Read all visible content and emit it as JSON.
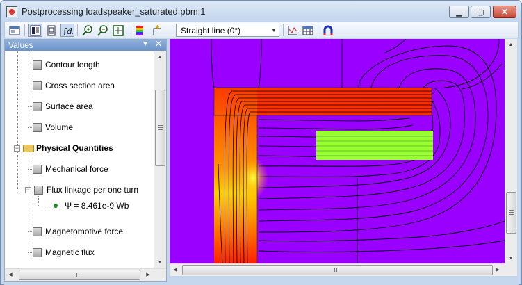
{
  "window": {
    "title": "Postprocessing loadspeaker_saturated.pbm:1",
    "minimize_symbol": "▁",
    "maximize_symbol": "▢",
    "close_symbol": "✕"
  },
  "toolbar": {
    "path_type": "Straight line (0°)",
    "icons": [
      "window-icon",
      "field-map-icon",
      "local-values-icon",
      "integral-icon",
      "zoom-in-icon",
      "zoom-out-icon",
      "zoom-fit-icon",
      "color-legend-icon",
      "new-contour-icon",
      "x-y-plot-icon",
      "table-icon",
      "magnet-icon"
    ]
  },
  "panel": {
    "title": "Values",
    "items": [
      {
        "label": "Contour length"
      },
      {
        "label": "Cross section area"
      },
      {
        "label": "Surface area"
      },
      {
        "label": "Volume"
      },
      {
        "label": "Physical Quantities"
      },
      {
        "label": "Mechanical force"
      },
      {
        "label": "Flux linkage per one turn"
      },
      {
        "label": "Ψ = 8.461e-9 Wb"
      },
      {
        "label": "Magnetomotive force"
      },
      {
        "label": "Magnetic flux"
      }
    ]
  },
  "plot": {
    "background_color": "#9900ff",
    "core_colors": [
      "#ff2000",
      "#ff7a00",
      "#ffd000",
      "#ffff33"
    ],
    "coil_color": "#99ff33",
    "field_line_color": "#000000"
  }
}
